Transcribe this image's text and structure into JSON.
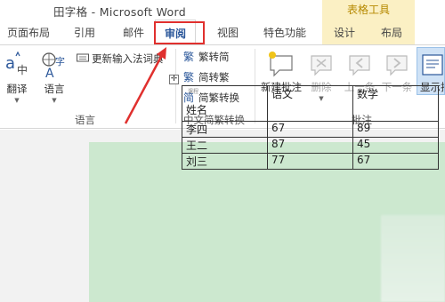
{
  "window": {
    "title": "田字格 - Microsoft Word",
    "context_title": "表格工具"
  },
  "tabs": [
    {
      "label": "页面布局"
    },
    {
      "label": "引用"
    },
    {
      "label": "邮件"
    },
    {
      "label": "审阅",
      "active": true
    },
    {
      "label": "视图"
    },
    {
      "label": "特色功能"
    },
    {
      "label": "设计"
    },
    {
      "label": "布局"
    }
  ],
  "ribbon": {
    "translate": {
      "label": "翻译"
    },
    "language": {
      "label": "语言"
    },
    "update_ime": {
      "label": "更新输入法词典"
    },
    "group_language": "语言",
    "to_simplified": {
      "label": "繁转简"
    },
    "to_traditional": {
      "label": "简转繁"
    },
    "convert": {
      "label": "简繁转换"
    },
    "group_chinese": "中文简繁转换",
    "new_comment": {
      "label": "新建批注"
    },
    "delete": {
      "label": "删除"
    },
    "previous": {
      "label": "上一条"
    },
    "next": {
      "label": "下一条"
    },
    "show_comments": {
      "label": "显示批注"
    },
    "group_comments": "批注"
  },
  "colors": {
    "accent": "#2b579a",
    "context": "#b68900",
    "highlight": "#e0302e",
    "page": "#cce8cf"
  },
  "document": {
    "table": {
      "header": {
        "corner_small": "课程",
        "corner": "姓名",
        "col1": "语文",
        "col2": "数学"
      },
      "rows": [
        {
          "name": "李四",
          "v1": "67",
          "v2": "89"
        },
        {
          "name": "王二",
          "v1": "87",
          "v2": "45"
        },
        {
          "name": "刘三",
          "v1": "77",
          "v2": "67"
        }
      ]
    }
  }
}
